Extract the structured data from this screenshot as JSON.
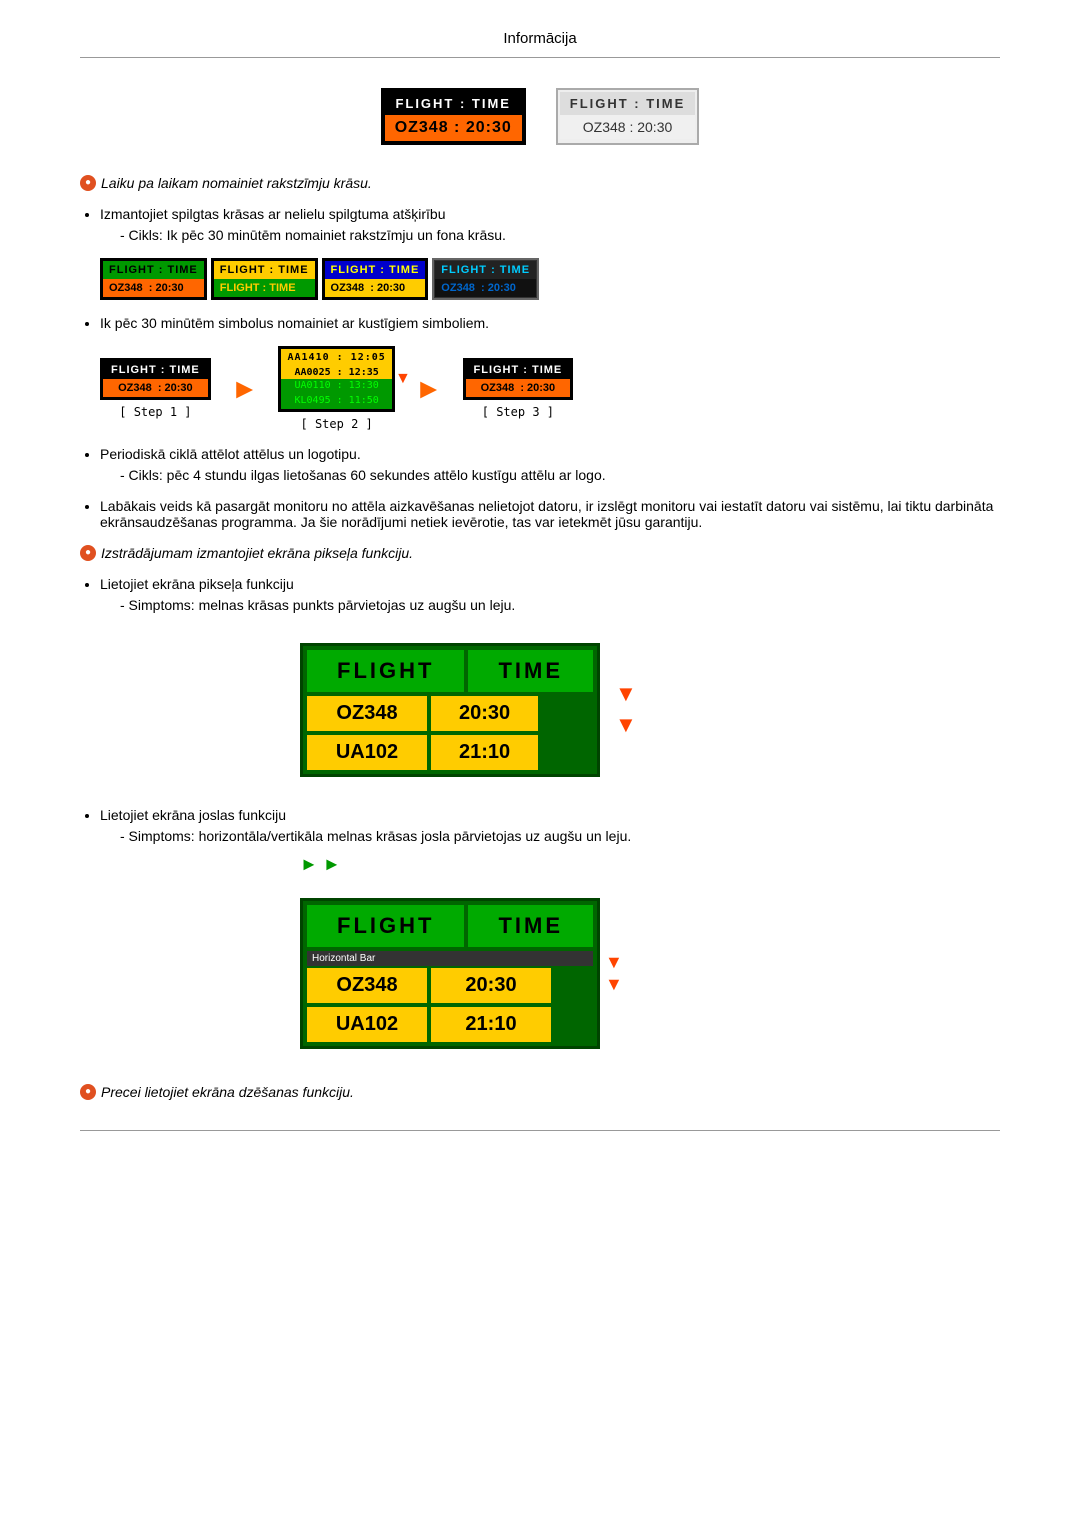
{
  "header": {
    "title": "Informācija"
  },
  "top_panels": {
    "panel1": {
      "header": "FLIGHT  :  TIME",
      "data": "OZ348  :  20:30",
      "type": "dark"
    },
    "panel2": {
      "header": "FLIGHT  :  TIME",
      "data": "OZ348  :  20:30",
      "type": "light"
    }
  },
  "note1": {
    "icon": "●",
    "text": "Laiku pa laikam nomainiet rakstzīmju krāsu."
  },
  "bullet1": {
    "text": "Izmantojiet spilgtas krāsas ar nelielu spilgtuma atšķirību"
  },
  "subnote1": {
    "text": "- Cikls: Ik pēc 30 minūtēm nomainiet rakstzīmju un fona krāsu."
  },
  "cycle_panels": [
    {
      "header": "FLIGHT : TIME",
      "data": "OZ348  : 20:30",
      "hbg": "#009900",
      "hcolor": "#000",
      "dbg": "#ff6600",
      "dcolor": "#000"
    },
    {
      "header": "FLIGHT : TIME",
      "data": "FLIGHT : TIME",
      "hbg": "#ffcc00",
      "hcolor": "#000",
      "dbg": "#009900",
      "dcolor": "#ffcc00"
    },
    {
      "header": "FLIGHT : TIME",
      "data": "OZ348  : 20:30",
      "hbg": "#0000cc",
      "hcolor": "#ffff00",
      "dbg": "#ffcc00",
      "dcolor": "#000"
    },
    {
      "header": "FLIGHT : TIME",
      "data": "OZ348  : 20:30",
      "hbg": "#222",
      "hcolor": "#00ccff",
      "dbg": "#111",
      "dcolor": "#0066cc"
    }
  ],
  "bullet2": {
    "text": "Ik pēc 30 minūtēm simbolus nomainiet ar kustīgiem simboliem."
  },
  "step1": {
    "panel_header": "FLIGHT : TIME",
    "panel_data": "OZ348  : 20:30",
    "label": "[ Step 1 ]"
  },
  "step2": {
    "panel_header": "AA1410 : 12:05",
    "panel_header2": "AA0025 : 12:35",
    "panel_data": "UA0110 : 13:30",
    "panel_data2": "KL0495 : 11:50",
    "label": "[ Step 2 ]"
  },
  "step3": {
    "panel_header": "FLIGHT : TIME",
    "panel_data": "OZ348  : 20:30",
    "label": "[ Step 3 ]"
  },
  "bullet3": {
    "text": "Periodiskā ciklā attēlot attēlus un logotipu."
  },
  "subnote3": {
    "text": "- Cikls: pēc 4 stundu ilgas lietošanas 60 sekundes attēlo kustīgu attēlu ar logo."
  },
  "bullet4": {
    "text": "Labākais veids kā pasargāt monitoru no attēla aizkavēšanas nelietojot datoru, ir izslēgt monitoru vai iestatīt datoru vai sistēmu, lai tiktu darbināta ekrānsaudzēšanas programma. Ja šie norādījumi netiek ievērotie, tas var ietekmēt jūsu garantiju."
  },
  "note2": {
    "icon": "●",
    "text": "Izstrādājumam izmantojiet ekrāna pikseļa funkciju."
  },
  "bullet5": {
    "text": "Lietojiet ekrāna pikseļa funkciju"
  },
  "subnote5": {
    "text": "- Simptoms: melnas krāsas punkts pārvietojas uz augšu un leju."
  },
  "large_display": {
    "col1_header": "FLIGHT",
    "col2_header": "TIME",
    "row1_col1": "OZ348",
    "row1_col2": "20:30",
    "row2_col1": "UA102",
    "row2_col2": "21:10"
  },
  "bullet6": {
    "text": "Lietojiet ekrāna joslas funkciju"
  },
  "subnote6": {
    "text": "- Simptoms: horizontāla/vertikāla melnas krāsas josla pārvietojas uz augšu un leju."
  },
  "hbar_display": {
    "col1_header": "FLIGHT",
    "col2_header": "TIME",
    "bar_label": "Horizontal Bar",
    "row1_col1": "OZ348",
    "row1_col2": "20:30",
    "row2_col1": "UA102",
    "row2_col2": "21:10"
  },
  "note3": {
    "icon": "●",
    "text": "Precei lietojiet ekrāna dzēšanas funkciju."
  }
}
